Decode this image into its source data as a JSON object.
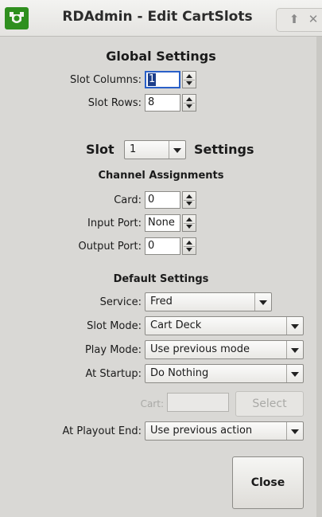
{
  "window": {
    "title": "RDAdmin - Edit CartSlots",
    "icon": "rdadmin-logo-icon",
    "accent": "#2f8f1e"
  },
  "global": {
    "heading": "Global Settings",
    "slot_columns_label": "Slot Columns:",
    "slot_columns_value": "1",
    "slot_rows_label": "Slot Rows:",
    "slot_rows_value": "8"
  },
  "slot": {
    "label_before": "Slot",
    "selected": "1",
    "label_after": "Settings"
  },
  "channels": {
    "heading": "Channel Assignments",
    "card_label": "Card:",
    "card_value": "0",
    "input_label": "Input Port:",
    "input_value": "None",
    "output_label": "Output Port:",
    "output_value": "0"
  },
  "defaults": {
    "heading": "Default Settings",
    "service_label": "Service:",
    "service_value": "Fred",
    "slot_mode_label": "Slot Mode:",
    "slot_mode_value": "Cart Deck",
    "play_mode_label": "Play Mode:",
    "play_mode_value": "Use previous mode",
    "startup_label": "At Startup:",
    "startup_value": "Do Nothing",
    "cart_label": "Cart:",
    "cart_value": "",
    "select_label": "Select",
    "playout_end_label": "At Playout End:",
    "playout_end_value": "Use previous action"
  },
  "actions": {
    "close_label": "Close"
  }
}
